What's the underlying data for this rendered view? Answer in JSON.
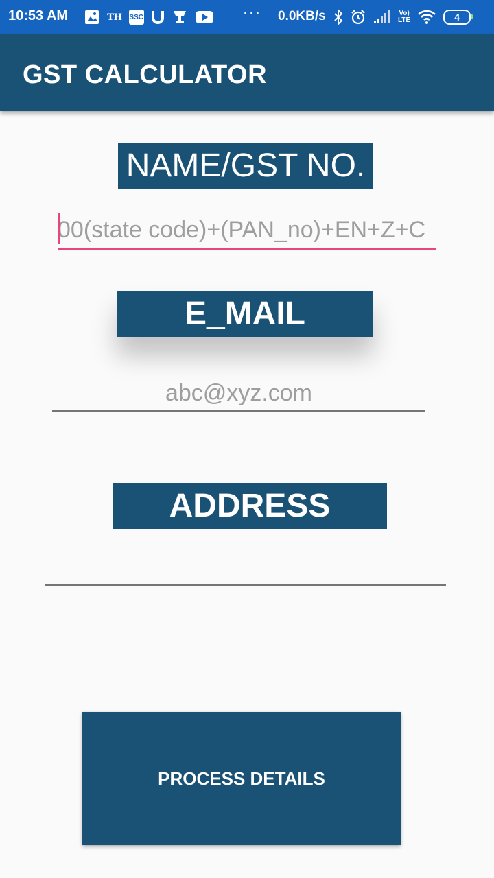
{
  "status_bar": {
    "time": "10:53 AM",
    "left_icons": [
      "gallery-icon",
      "th-icon",
      "ssc-icon",
      "u-icon",
      "trophy-icon",
      "youtube-icon"
    ],
    "th_text": "TH",
    "ssc_text": "SSC",
    "u_text": "U",
    "more_dots": "···",
    "network_speed": "0.0KB/s",
    "right_icons": [
      "bluetooth-icon",
      "alarm-icon",
      "signal-icon",
      "volte-icon",
      "wifi-icon",
      "battery-icon"
    ],
    "volte_text": "Vo)\nLTE",
    "battery_level": "4"
  },
  "app_bar": {
    "title": "GST CALCULATOR",
    "background": "#1a5276"
  },
  "form": {
    "name_label": "NAME/GST NO.",
    "gst_placeholder": "00(state code)+(PAN_no)+EN+Z+C",
    "email_label": "E_MAIL",
    "email_placeholder": "abc@xyz.com",
    "address_label": "ADDRESS",
    "address_placeholder": ""
  },
  "actions": {
    "process_label": "PROCESS DETAILS"
  },
  "colors": {
    "status_bar": "#1565c0",
    "primary": "#1a5276",
    "accent": "#e8457a",
    "background": "#fafafa"
  }
}
